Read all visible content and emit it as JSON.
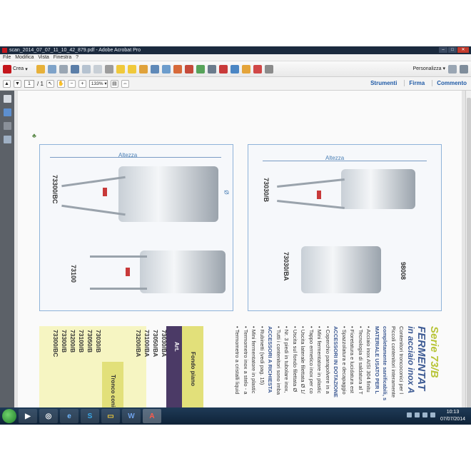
{
  "window": {
    "title": "scan_2014_07_07_11_10_42_879.pdf - Adobe Acrobat Pro",
    "controls": [
      "–",
      "□",
      "✕"
    ]
  },
  "menu": [
    "File",
    "Modifica",
    "Vista",
    "Finestra",
    "?"
  ],
  "toolbar": {
    "create_label": "Crea",
    "customize_label": "Personalizza"
  },
  "navbar": {
    "page_current": "1",
    "page_total": "/ 1",
    "zoom": "133%",
    "links": [
      "Strumenti",
      "Firma",
      "Commento"
    ]
  },
  "document": {
    "dim_label_left": "Altezza",
    "dim_label_right": "Altezza",
    "diameter_symbol": "Ø",
    "models_left": [
      "73300/BC",
      "73100"
    ],
    "models_right": [
      "73030/B",
      "73030/BA",
      "98008"
    ],
    "table": {
      "header_art": "Art.",
      "header_fondo_piano": "Fondo piano",
      "header_tronco": "Tronco conico",
      "rows": [
        "73030/BA",
        "73050/BA",
        "73100/BA",
        "73200/BA",
        "73030/B",
        "73050/B",
        "73100/B",
        "73200/B",
        "73300/B",
        "73300/BC"
      ]
    },
    "title_series": "Serie 73/B",
    "title_line1": "FERMENTAT",
    "title_line2": "in acciaio inox A",
    "text_lines": [
      "Contenitori troncoconici per l",
      "Piccoli contenitori interamente",
      "completamente sanificabili, s",
      "MATERIALE USATO PER L",
      "• Acciaio inox AISI 304 finitu",
      "• Tecnologia di saldatura al T",
      "• Fioretatura e lucidatura est",
      "• Spazzolatura e decapaggio",
      "ACCESSORI IN DOTAZIONE",
      "• Coperchio parapolvere in a",
      "• Mini fermentatore in plastic",
      "• Tappo ermetico inox per co",
      "• Uscita laterale filettata Ø 1/",
      "• Uscita sul fondo filettata Ø",
      "• Nr. 3 piedi in tubolare inox,",
      "• Tutti i contenitori sono imba",
      "ACCESSORI A RICHIESTA",
      "• Rubinetti (vedi pag. 15)",
      "• Mini fermentatore in plastic",
      "• Termometro inox a stelo - a",
      "• Termometro a cristalli liquid"
    ]
  },
  "taskbar": {
    "apps": [
      "▶",
      "◎",
      "e",
      "S",
      "▭",
      "W",
      "A"
    ],
    "time": "10:13",
    "date": "07/07/2014"
  }
}
